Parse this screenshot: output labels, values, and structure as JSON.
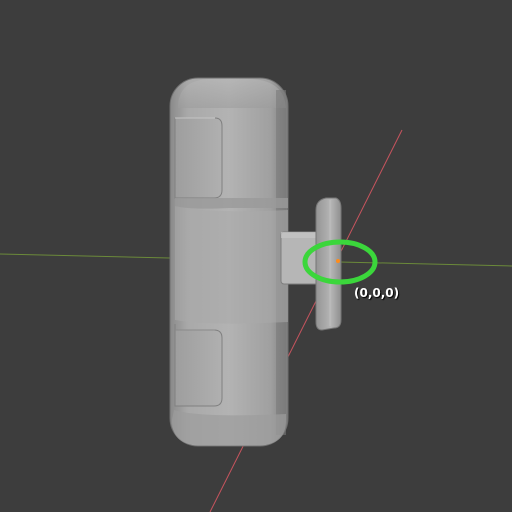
{
  "viewport": {
    "background": "#3d3d3d",
    "x_axis_color": "#c7545e",
    "y_axis_color": "#6b8a3a",
    "highlight_color": "#3bd63b",
    "origin_point_color": "#ff8c1a",
    "model_color": "#a9a9a9"
  },
  "origin": {
    "label": "(0,0,0)"
  }
}
